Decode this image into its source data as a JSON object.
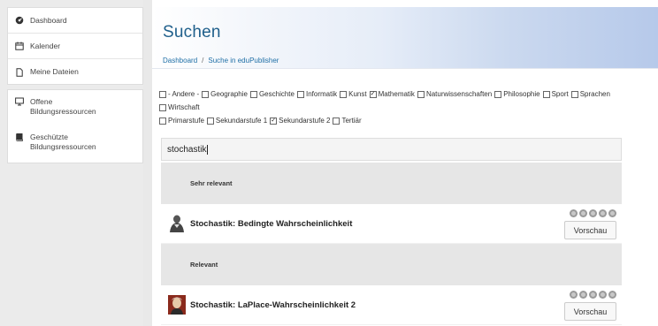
{
  "sidebar": {
    "primary": [
      {
        "label": "Dashboard",
        "icon": "dashboard-icon"
      },
      {
        "label": "Kalender",
        "icon": "calendar-icon"
      },
      {
        "label": "Meine Dateien",
        "icon": "file-icon"
      }
    ],
    "secondary": [
      {
        "label_line1": "Offene",
        "label_line2": "Bildungsressourcen",
        "icon": "monitor-icon"
      },
      {
        "label_line1": "Geschützte",
        "label_line2": "Bildungsressourcen",
        "icon": "book-icon"
      }
    ]
  },
  "header": {
    "title": "Suchen",
    "breadcrumb": [
      "Dashboard",
      "Suche in eduPublisher"
    ]
  },
  "filters": {
    "subjects": [
      {
        "label": "- Andere -",
        "checked": false
      },
      {
        "label": "Geographie",
        "checked": false
      },
      {
        "label": "Geschichte",
        "checked": false
      },
      {
        "label": "Informatik",
        "checked": false
      },
      {
        "label": "Kunst",
        "checked": true
      },
      {
        "label": "Mathematik",
        "checked": false
      },
      {
        "label": "Naturwissenschaften",
        "checked": false
      },
      {
        "label": "Philosophie",
        "checked": false
      },
      {
        "label": "Sport",
        "checked": false
      },
      {
        "label": "Sprachen",
        "checked": false
      },
      {
        "label": "Wirtschaft",
        "checked": false
      }
    ],
    "levels": [
      {
        "label": "Primarstufe",
        "checked": false
      },
      {
        "label": "Sekundarstufe 1",
        "checked": true
      },
      {
        "label": "Sekundarstufe 2",
        "checked": false
      },
      {
        "label": "Tertiär",
        "checked": false
      }
    ]
  },
  "search": {
    "value": "stochastik"
  },
  "results": {
    "group1": "Sehr relevant",
    "item1": {
      "title": "Stochastik: Bedingte Wahrscheinlichkeit",
      "button": "Vorschau"
    },
    "group2": "Relevant",
    "item2": {
      "title": "Stochastik: LaPlace-Wahrscheinlichkeit 2",
      "button": "Vorschau"
    }
  },
  "colors": {
    "title": "#1f5f8b",
    "link": "#1f6fa6"
  }
}
